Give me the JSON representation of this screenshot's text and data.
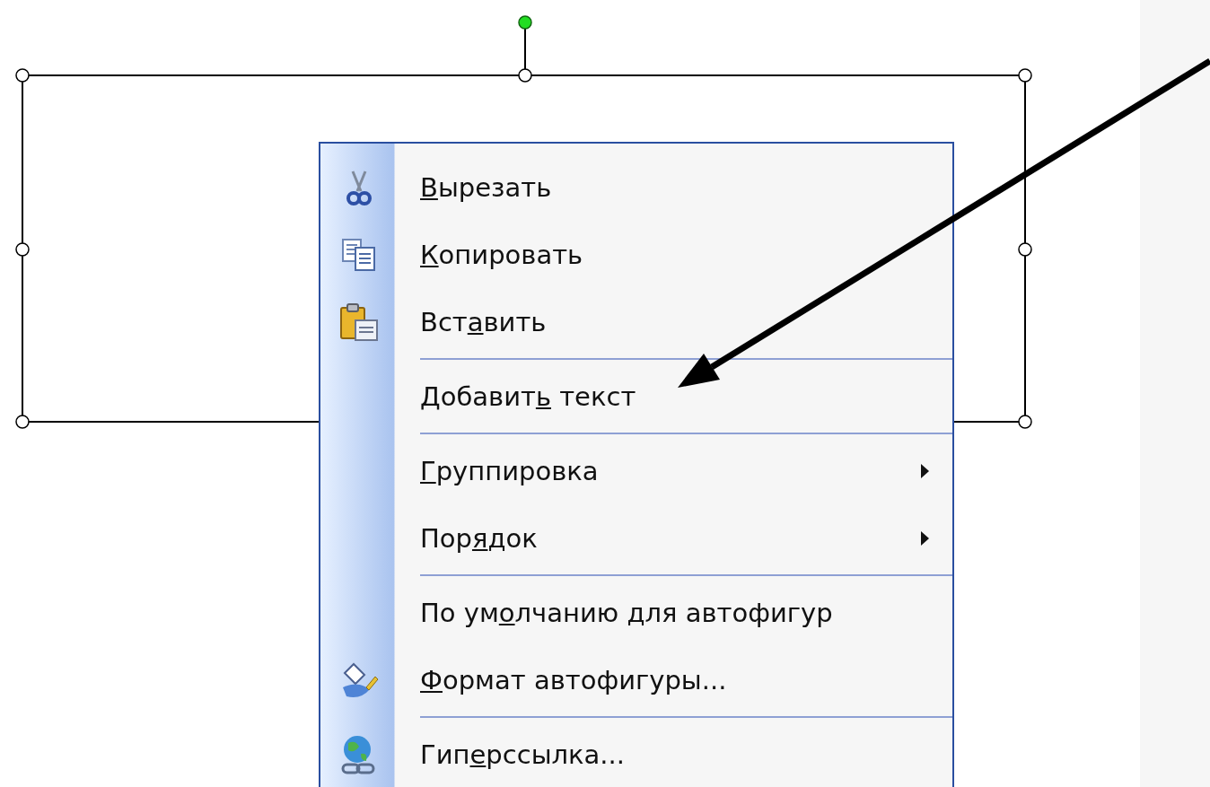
{
  "menu": {
    "items": [
      {
        "kind": "item",
        "key": "В",
        "after": "ырезать",
        "submenu": false
      },
      {
        "kind": "item",
        "key": "К",
        "after": "опировать",
        "submenu": false
      },
      {
        "kind": "item",
        "before": "Вст",
        "key": "а",
        "after": "вить",
        "submenu": false
      },
      {
        "kind": "separator"
      },
      {
        "kind": "item",
        "before": "Добавит",
        "key": "ь",
        "after": " текст",
        "submenu": false
      },
      {
        "kind": "separator"
      },
      {
        "kind": "item",
        "key": "Г",
        "after": "руппировка",
        "submenu": true
      },
      {
        "kind": "item",
        "before": "Пор",
        "key": "я",
        "after": "док",
        "submenu": true
      },
      {
        "kind": "separator"
      },
      {
        "kind": "item",
        "before": "По ум",
        "key": "о",
        "after": "лчанию для автофигур",
        "submenu": false
      },
      {
        "kind": "item",
        "key": "Ф",
        "after": "ормат автофигуры...",
        "submenu": false
      },
      {
        "kind": "separator"
      },
      {
        "kind": "item",
        "before": "Гип",
        "key": "е",
        "after": "рссылка...",
        "submenu": false
      }
    ]
  }
}
